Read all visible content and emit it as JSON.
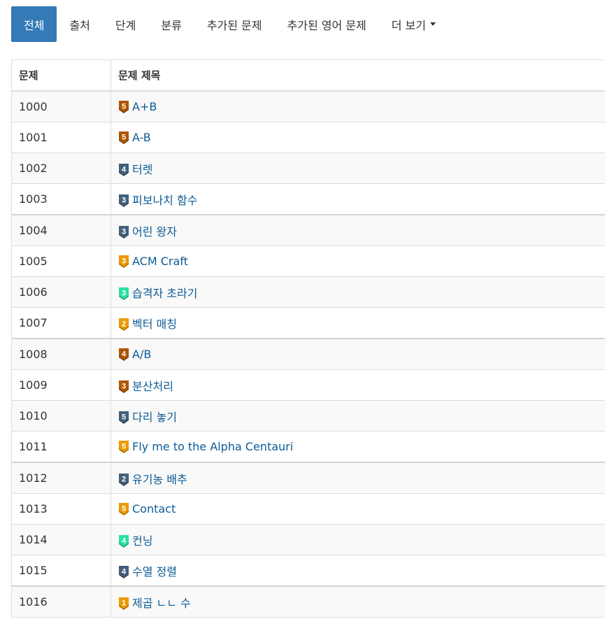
{
  "tabs": [
    {
      "label": "전체",
      "active": true
    },
    {
      "label": "출처"
    },
    {
      "label": "단계"
    },
    {
      "label": "분류"
    },
    {
      "label": "추가된 문제"
    },
    {
      "label": "추가된 영어 문제"
    },
    {
      "label": "더 보기"
    }
  ],
  "table": {
    "headers": {
      "id": "문제",
      "title": "문제 제목"
    },
    "rows": [
      {
        "id": "1000",
        "title": "A+B",
        "tier": "5",
        "tier_color": "#ad5600"
      },
      {
        "id": "1001",
        "title": "A-B",
        "tier": "5",
        "tier_color": "#ad5600"
      },
      {
        "id": "1002",
        "title": "터렛",
        "tier": "4",
        "tier_color": "#435f7a"
      },
      {
        "id": "1003",
        "title": "피보나치 함수",
        "tier": "3",
        "tier_color": "#435f7a"
      },
      {
        "id": "1004",
        "title": "어린 왕자",
        "tier": "3",
        "tier_color": "#435f7a"
      },
      {
        "id": "1005",
        "title": "ACM Craft",
        "tier": "3",
        "tier_color": "#ec9a00"
      },
      {
        "id": "1006",
        "title": "습격자 초라기",
        "tier": "3",
        "tier_color": "#27e2a4"
      },
      {
        "id": "1007",
        "title": "벡터 매칭",
        "tier": "2",
        "tier_color": "#ec9a00"
      },
      {
        "id": "1008",
        "title": "A/B",
        "tier": "4",
        "tier_color": "#ad5600"
      },
      {
        "id": "1009",
        "title": "분산처리",
        "tier": "3",
        "tier_color": "#ad5600"
      },
      {
        "id": "1010",
        "title": "다리 놓기",
        "tier": "5",
        "tier_color": "#435f7a"
      },
      {
        "id": "1011",
        "title": "Fly me to the Alpha Centauri",
        "tier": "5",
        "tier_color": "#ec9a00"
      },
      {
        "id": "1012",
        "title": "유기농 배추",
        "tier": "2",
        "tier_color": "#435f7a"
      },
      {
        "id": "1013",
        "title": "Contact",
        "tier": "5",
        "tier_color": "#ec9a00"
      },
      {
        "id": "1014",
        "title": "컨닝",
        "tier": "4",
        "tier_color": "#27e2a4"
      },
      {
        "id": "1015",
        "title": "수열 정렬",
        "tier": "4",
        "tier_color": "#435f7a"
      },
      {
        "id": "1016",
        "title": "제곱 ㄴㄴ 수",
        "tier": "1",
        "tier_color": "#ec9a00"
      }
    ]
  }
}
